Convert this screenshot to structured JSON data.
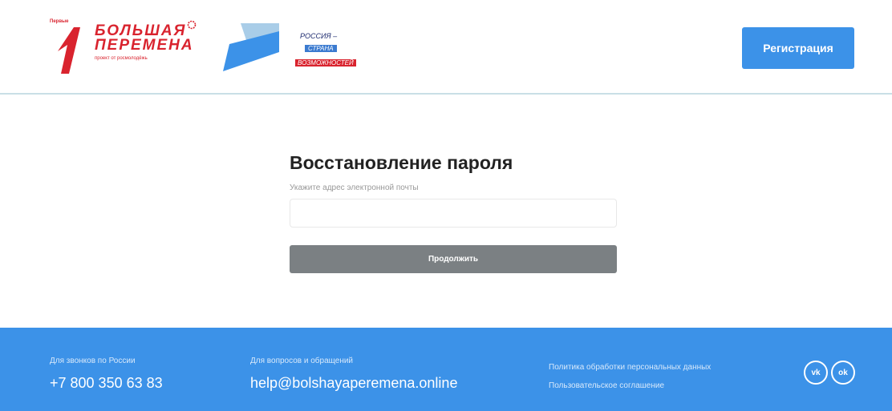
{
  "header": {
    "logo_first": {
      "label": "Первые"
    },
    "logo_bp": {
      "line1": "БОЛЬШАЯ",
      "line2": "ПЕРЕМЕНА",
      "line3": "проект от росмолодёжь"
    },
    "logo_rsv": {
      "r1": "РОССИЯ –",
      "r2": "СТРАНА",
      "r3": "ВОЗМОЖНОСТЕЙ"
    },
    "register_label": "Регистрация"
  },
  "main": {
    "title": "Восстановление пароля",
    "email_label": "Укажите адрес электронной почты",
    "email_value": "",
    "continue_label": "Продолжить"
  },
  "footer": {
    "calls_label": "Для звонков по России",
    "phone": "+7 800 350 63 83",
    "questions_label": "Для вопросов и обращений",
    "email": "help@bolshayaperemena.online",
    "policy_link": "Политика обработки персональных данных",
    "agreement_link": "Пользовательское соглашение",
    "vk_label": "vk",
    "ok_label": "ok"
  },
  "colors": {
    "accent": "#3c92e8",
    "brand_red": "#d9232e",
    "button_disabled": "#7b8083"
  }
}
